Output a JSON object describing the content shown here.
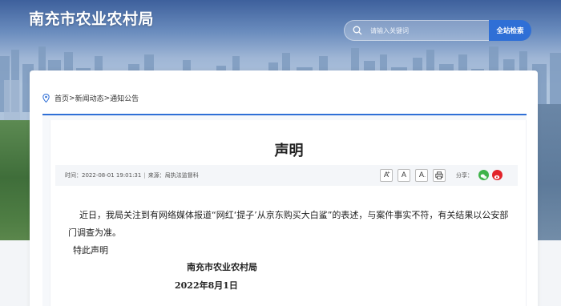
{
  "header": {
    "site_title": "南充市农业农村局",
    "search_placeholder": "请输入关键词",
    "search_button": "全站检索"
  },
  "breadcrumb": {
    "items": [
      "首页",
      "新闻动态",
      "通知公告"
    ],
    "separator": ">"
  },
  "article": {
    "title": "声明",
    "meta": {
      "time_label": "时间：",
      "time_value": "2022-08-01 19:01:31",
      "source_label": "来源：",
      "source_value": "局执法监督科",
      "font_large": "A",
      "font_medium": "A",
      "font_small": "A",
      "share_label": "分享："
    },
    "body": [
      "近日，我局关注到有网络媒体报道“网红‘提子’从京东购买大白鲨”的表述，与案件事实不符，有关结果以公安部门调查为准。",
      "特此声明"
    ],
    "signature_org": "南充市农业农村局",
    "signature_date": "2022年8月1日"
  },
  "colors": {
    "accent": "#2f6fd6",
    "wechat": "#3fb34a",
    "weibo": "#e2232a"
  },
  "icons": {
    "search": "search-icon",
    "location": "pin-icon",
    "print": "print-icon",
    "wechat": "wechat-icon",
    "weibo": "weibo-icon"
  }
}
